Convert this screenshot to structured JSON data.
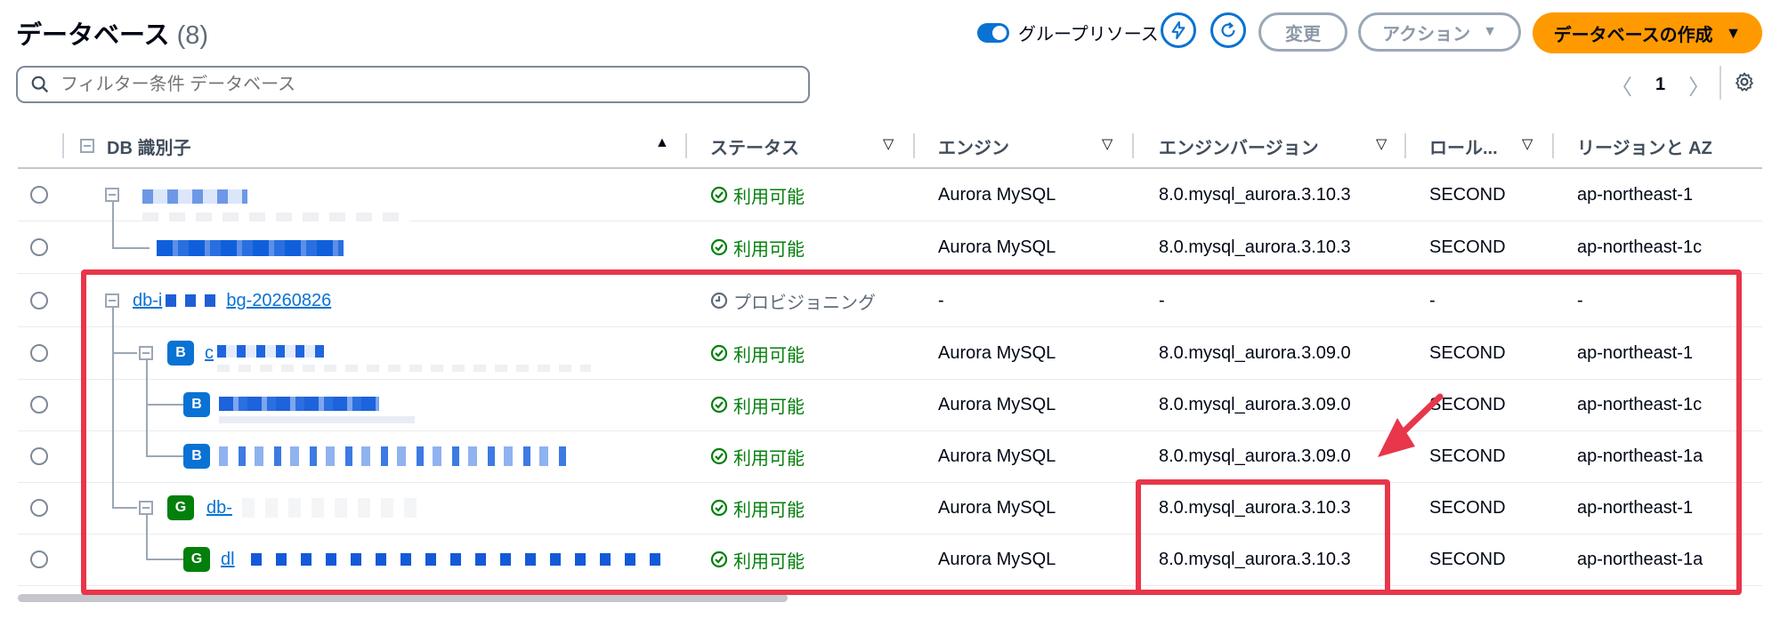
{
  "header": {
    "title": "データベース",
    "count": "(8)",
    "group_toggle_label": "グループリソース",
    "modify_label": "変更",
    "actions_label": "アクション",
    "create_label": "データベースの作成"
  },
  "filter": {
    "placeholder": "フィルター条件 データベース"
  },
  "pagination": {
    "prev": "〈",
    "page": "1",
    "next": "〉"
  },
  "columns": {
    "db_id": "DB 識別子",
    "status": "ステータス",
    "engine": "エンジン",
    "engine_version": "エンジンバージョン",
    "role": "ロール...",
    "region": "リージョンと AZ"
  },
  "rows": [
    {
      "id": "",
      "status": "利用可能",
      "engine": "Aurora MySQL",
      "version": "8.0.mysql_aurora.3.10.3",
      "role": "SECOND",
      "region": "ap-northeast-1"
    },
    {
      "id": "",
      "status": "利用可能",
      "engine": "Aurora MySQL",
      "version": "8.0.mysql_aurora.3.10.3",
      "role": "SECOND",
      "region": "ap-northeast-1c"
    },
    {
      "id_prefix": "db-i",
      "id_suffix": "bg-20260826",
      "status": "プロビジョニング",
      "engine": "-",
      "version": "-",
      "role": "-",
      "region": "-"
    },
    {
      "id": "c",
      "badge": "B",
      "status": "利用可能",
      "engine": "Aurora MySQL",
      "version": "8.0.mysql_aurora.3.09.0",
      "role": "SECOND",
      "region": "ap-northeast-1"
    },
    {
      "id": "",
      "badge": "B",
      "status": "利用可能",
      "engine": "Aurora MySQL",
      "version": "8.0.mysql_aurora.3.09.0",
      "role": "SECOND",
      "region": "ap-northeast-1c"
    },
    {
      "id": "",
      "badge": "B",
      "status": "利用可能",
      "engine": "Aurora MySQL",
      "version": "8.0.mysql_aurora.3.09.0",
      "role": "SECOND",
      "region": "ap-northeast-1a"
    },
    {
      "id": "db-",
      "badge": "G",
      "status": "利用可能",
      "engine": "Aurora MySQL",
      "version": "8.0.mysql_aurora.3.10.3",
      "role": "SECOND",
      "region": "ap-northeast-1"
    },
    {
      "id": "dl",
      "badge": "G",
      "status": "利用可能",
      "engine": "Aurora MySQL",
      "version": "8.0.mysql_aurora.3.10.3",
      "role": "SECOND",
      "region": "ap-northeast-1a"
    }
  ],
  "colors": {
    "primary": "#ff9900",
    "link": "#0972d3",
    "success": "#037f0c",
    "annotation": "#e8364a",
    "blue_badge": "#0972d3",
    "green_badge": "#037f0c"
  }
}
